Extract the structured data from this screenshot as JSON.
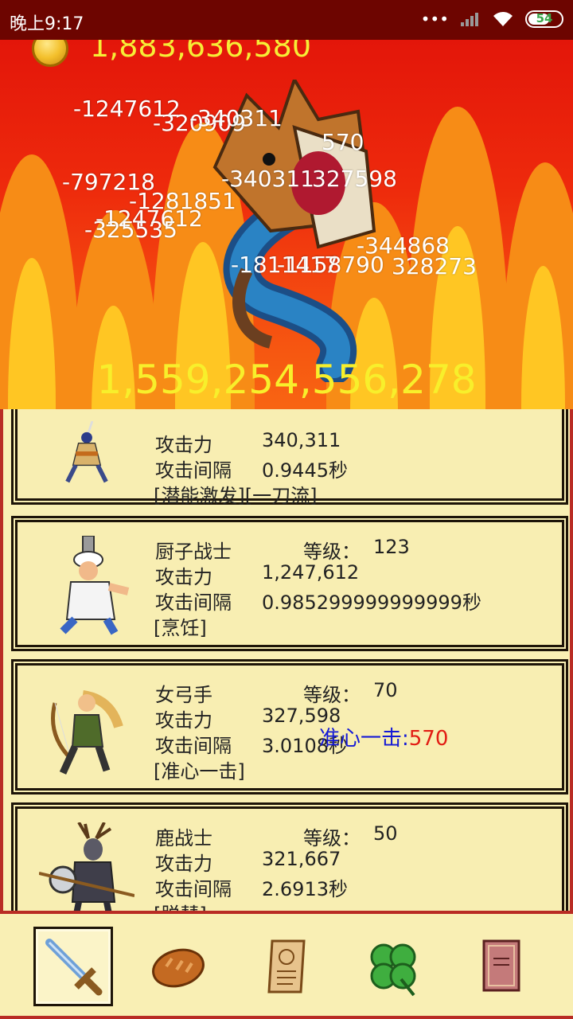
{
  "status_bar": {
    "time": "晚上9:17",
    "battery": "54",
    "signal_glyph": "•••"
  },
  "battle": {
    "gold": "1,883,636,580",
    "boss_hp": "1,559,254,556,278",
    "damage_numbers": [
      "-1247612",
      "-320909",
      "-340311",
      "570",
      "-797218",
      "-340311",
      "327598",
      "-1281851",
      "-1247612",
      "-325535",
      "-344868",
      "-1811417",
      "-1158790",
      "328273"
    ]
  },
  "heroes": [
    {
      "name": "",
      "level_label": "",
      "level": "",
      "attack_label": "攻击力",
      "attack": "340,311",
      "interval_label": "攻击间隔",
      "interval": "0.9445秒",
      "skill": "[潜能激发][一刀流]"
    },
    {
      "name": "厨子战士",
      "level_label": "等级：",
      "level": "123",
      "attack_label": "攻击力",
      "attack": "1,247,612",
      "interval_label": "攻击间隔",
      "interval": "0.985299999999999秒",
      "skill": "[烹饪]"
    },
    {
      "name": "女弓手",
      "level_label": "等级：",
      "level": "70",
      "attack_label": "攻击力",
      "attack": "327,598",
      "interval_label": "攻击间隔",
      "interval": "3.0108秒",
      "skill": "[准心一击]"
    },
    {
      "name": "鹿战士",
      "level_label": "等级：",
      "level": "50",
      "attack_label": "攻击力",
      "attack": "321,667",
      "interval_label": "攻击间隔",
      "interval": "2.6913秒",
      "skill": "[脱彗]"
    }
  ],
  "archer_popup": {
    "label": "准心一击:",
    "value": "570"
  },
  "toolbar": {
    "items": [
      {
        "icon": "sword-icon",
        "selected": true
      },
      {
        "icon": "bread-icon",
        "selected": false
      },
      {
        "icon": "scroll-icon",
        "selected": false
      },
      {
        "icon": "clover-icon",
        "selected": false
      },
      {
        "icon": "book-icon",
        "selected": false
      }
    ]
  }
}
